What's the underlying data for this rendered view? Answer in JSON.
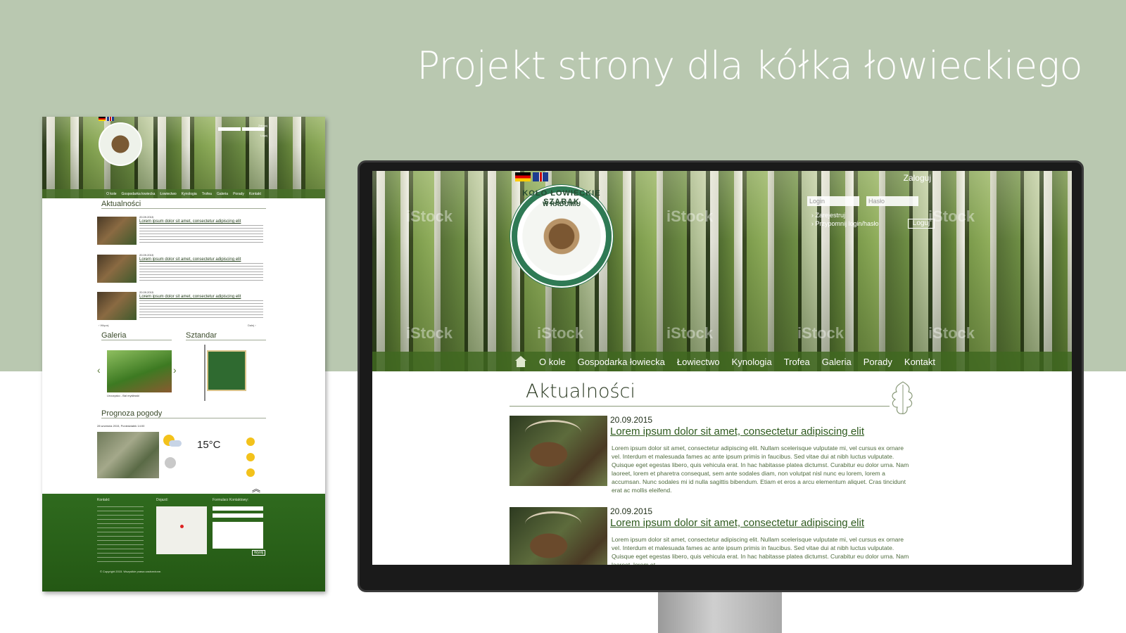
{
  "heading": "Projekt strony dla kółka łowieckiego",
  "monitor": {
    "login_link": "Zaloguj",
    "login_placeholder": "Login",
    "password_placeholder": "Hasło",
    "register_link": "› Zarejestruj",
    "remind_link": "› Przypomnij login/hasło",
    "login_button": "Loguj",
    "emblem_line1": "KOŁO ŁOWIECKIE SZARAK",
    "emblem_line2": "W RADOMIU",
    "nav": [
      "O kole",
      "Gospodarka łowiecka",
      "Łowiectwo",
      "Kynologia",
      "Trofea",
      "Galeria",
      "Porady",
      "Kontakt"
    ],
    "section_title": "Aktualności",
    "articles": [
      {
        "date": "20.09.2015",
        "title": "Lorem ipsum dolor sit amet, consectetur adipiscing elit",
        "body": "Lorem ipsum dolor sit amet, consectetur adipiscing elit. Nullam scelerisque vulputate mi, vel cursus ex ornare vel. Interdum et malesuada fames ac ante ipsum primis in faucibus. Sed vitae dui at nibh luctus vulputate. Quisque eget egestas libero, quis vehicula erat. In hac habitasse platea dictumst. Curabitur eu dolor urna. Nam laoreet, lorem et pharetra consequat, sem ante sodales diam, non volutpat nisl nunc eu lorem, lorem a accumsan. Nunc sodales mi id nulla sagittis bibendum. Etiam et eros a arcu elementum aliquet. Cras tincidunt erat ac mollis eleifend."
      },
      {
        "date": "20.09.2015",
        "title": "Lorem ipsum dolor sit amet, consectetur adipiscing elit",
        "body": "Lorem ipsum dolor sit amet, consectetur adipiscing elit. Nullam scelerisque vulputate mi, vel cursus ex ornare vel. Interdum et malesuada fames ac ante ipsum primis in faucibus. Sed vitae dui at nibh luctus vulputate. Quisque eget egestas libero, quis vehicula erat. In hac habitasse platea dictumst. Curabitur eu dolor urna. Nam laoreet, lorem et"
      }
    ],
    "watermark": "iStock"
  },
  "page_mockup": {
    "login_link": "Zaloguj",
    "login_button": "Loguj",
    "nav": [
      "O kole",
      "Gospodarka łowiecka",
      "Łowiectwo",
      "Kynologia",
      "Trofea",
      "Galeria",
      "Porady",
      "Kontakt"
    ],
    "news_title": "Aktualności",
    "news": [
      {
        "date": "20.09.2015",
        "title": "Lorem ipsum dolor sit amet, consectetur adipiscing elit"
      },
      {
        "date": "20.09.2015",
        "title": "Lorem ipsum dolor sit amet, consectetur adipiscing elit"
      },
      {
        "date": "20.09.2015",
        "title": "Lorem ipsum dolor sit amet, consectetur adipiscing elit"
      }
    ],
    "more_left": "‹ Więcej",
    "more_right": "Dalej ›",
    "gallery_title": "Galeria",
    "gallery_caption": "Uroczysko - Bal myśliwski",
    "banner_title": "Sztandar",
    "weather_title": "Prognoza pogody",
    "weather_date": "28 września 2015, Poniedziałek 14:00",
    "temperature": "15°C",
    "footer_contact": "Kontakt:",
    "footer_directions": "Dojazd:",
    "footer_form": "Formularz Kontaktowy:",
    "footer_send": "Wyślij",
    "footer_copyright": "© Copyright 2015. Wszystkie prawa zastrzeżone."
  },
  "colors": {
    "background_band": "#b9c8b0",
    "nav_green": "#406820",
    "footer_green": "#2f6a1e",
    "link_green": "#2e5a1e"
  }
}
